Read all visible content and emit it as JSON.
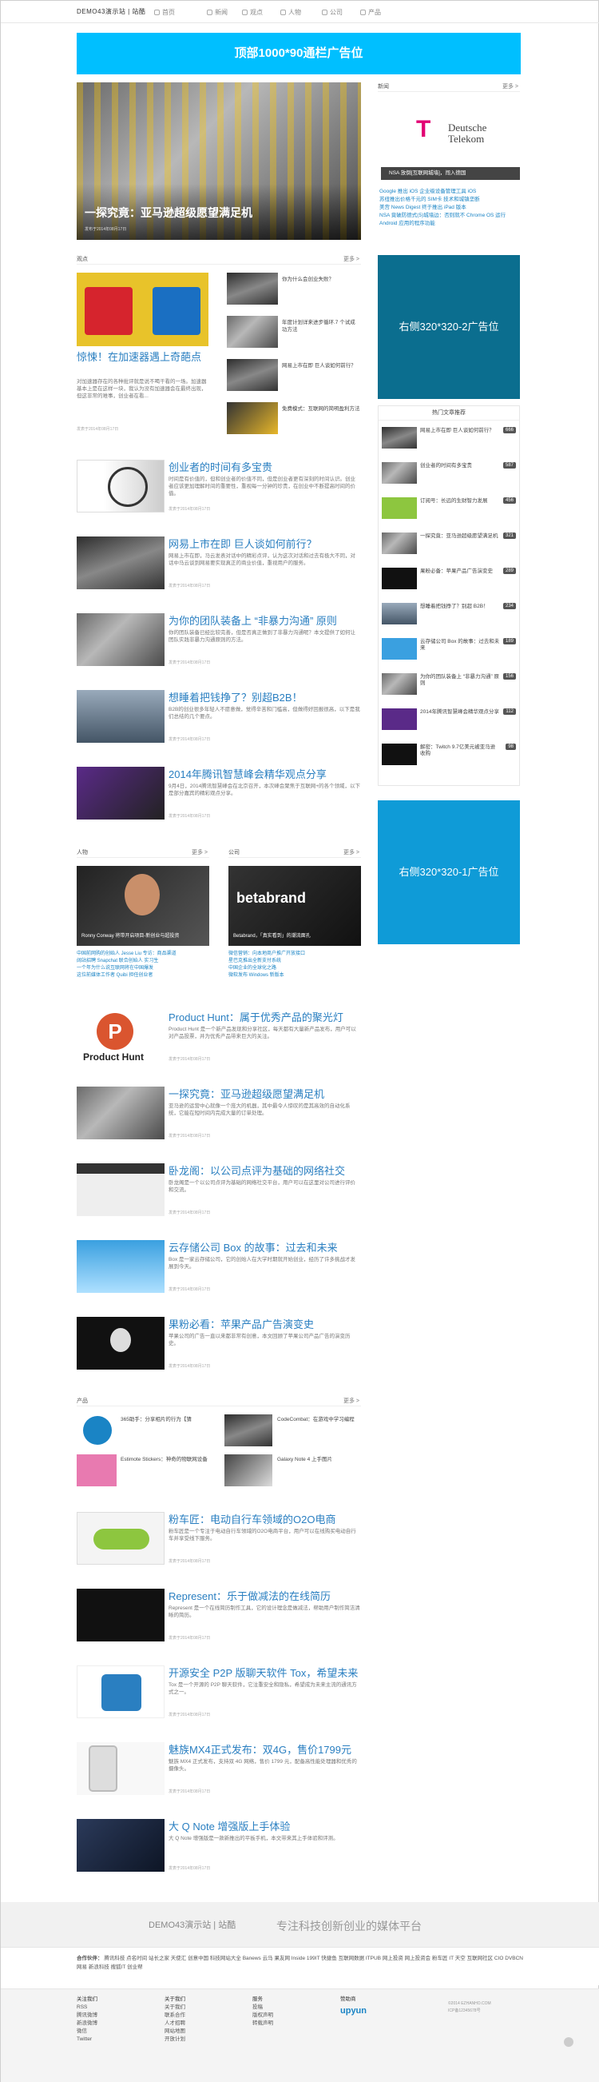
{
  "header": {
    "logo": "DEMO43演示站 | 站酷",
    "nav": [
      "首页",
      "新闻",
      "观点",
      "人物",
      "公司",
      "产品"
    ]
  },
  "ads": {
    "top": "顶部1000*90通栏广告位",
    "right1": "右侧320*320-2广告位",
    "right2": "右侧320*320-1广告位"
  },
  "hero": {
    "title": "一探究竟：亚马逊超级愿望满足机",
    "date": "发布于2014年08月17日"
  },
  "views": {
    "label": "观点",
    "more": "更多 >",
    "feature": {
      "title": "惊悚！在加速器遇上奇葩点",
      "desc": "对加速器存在的各种批评就是说不喝干看的一场。加速器基本上是在这样一块，我认为没有加速器会在最终出现，但这非常的难事，创业者在看...",
      "meta": "发表于2014年08月17日"
    },
    "side": [
      "你为什么会创业失败？",
      "年度计划详来进步循环.7 个试成功方法",
      "网易上市在即 巨人谈如何前行？",
      "免费模式：互联网的简明盈利方法"
    ]
  },
  "news": {
    "label": "新闻",
    "more": "更多 >",
    "brand": "Deutsche\nTelekom",
    "caption": "NSA 放倒[互联网城墙]，闯入德国",
    "links": [
      "Google 推出 iOS 企业级设备管理工具 iOS",
      "苏纽推出价格千元的 SIM卡 技术和城镇垄断",
      "美宫 News Digest 终于推出 iPad 版本",
      "NSA 竟破防德式(5)城墙边：否则就不 Chrome OS 运行 Android 应用的程序功能"
    ]
  },
  "articles": [
    {
      "title": "创业者的时间有多宝贵",
      "desc": "时间是有价值的，但和创业者的价值不同，但是创业者更有深刻的时间认识。创业者应该更加理解时间的重要性，重视每一分钟的珍贵，在创业中不断提高时间的价值。",
      "meta": "发表于2014年08月17日"
    },
    {
      "title": "网易上市在即 巨人谈如何前行？",
      "desc": "网易上市在即，马云发表对话中的精彩点评，认为这次对话和过去有极大不同，对话中马云谈到网易要实现真正的商业价值，重视用户的服务。",
      "meta": "发表于2014年08月17日"
    },
    {
      "title": "为你的团队装备上 “非暴力沟通” 原则",
      "desc": "你的团队装备已经比较完善，但是否真正做到了非暴力沟通呢？本文提供了如何让团队实践非暴力沟通原则的方法。",
      "meta": "发表于2014年08月17日"
    },
    {
      "title": "想睡着把钱挣了？别超B2B！",
      "desc": "B2B的创业很多年轻人不愿意做，觉得辛苦和门槛高，但做得好回报很高，以下是我们总结的几个要点。",
      "meta": "发表于2014年08月17日"
    },
    {
      "title": "2014年腾讯智慧峰会精华观点分享",
      "desc": "9月4日，2014腾讯智慧峰会在北京召开，本次峰会聚焦于互联网+的各个领域，以下是部分嘉宾的精彩观点分享。",
      "meta": "发表于2014年08月17日"
    }
  ],
  "people": {
    "label": "人物",
    "more": "更多 >",
    "caption": "Ronny Conway 将带开启项目-新创业与超投资",
    "links": [
      "中国前网购的创始人 Jesse Liu 专访：商品渠道",
      "阔站招聘 Snapchat 联合创始人 实习生",
      "一个年为什么说互联网将在中国爆发",
      "这位前媒体工作者 Quibi 担任创业者"
    ]
  },
  "company": {
    "label": "公司",
    "more": "更多 >",
    "caption": "Betabrand，「真实看到」的潮流面孔",
    "links": [
      "微信营销：向本地商户推广开放接口",
      "星巴克推出全新支付系统",
      "中国企业的全球化之路",
      "微软发布 Windows 新版本"
    ]
  },
  "articles2": [
    {
      "title": "Product Hunt：属于优秀产品的聚光灯",
      "desc": "Product Hunt 是一个新产品发现和分享社区，每天都有大量新产品发布，用户可以对产品投票，并为优秀产品带来巨大的关注。",
      "meta": "发表于2014年08月17日"
    },
    {
      "title": "一探究竟：亚马逊超级愿望满足机",
      "desc": "亚马逊的运营中心就像一个庞大的机器，其中最令人惊叹的是其高效的自动化系统，它能在短时间内完成大量的订单处理。",
      "meta": "发表于2014年08月17日"
    },
    {
      "title": "卧龙阁：以公司点评为基础的网络社交",
      "desc": "卧龙阁是一个以公司点评为基础的网络社交平台，用户可以在这里对公司进行评价和交流。",
      "meta": "发表于2014年08月17日"
    },
    {
      "title": "云存储公司 Box 的故事：过去和未来",
      "desc": "Box 是一家云存储公司，它的创始人在大学时期就开始创业，经历了许多挑战才发展到今天。",
      "meta": "发表于2014年08月17日"
    },
    {
      "title": "果粉必看：苹果产品广告演变史",
      "desc": "苹果公司的广告一直以来都非常有创意，本文回顾了苹果公司产品广告的演变历史。",
      "meta": "发表于2014年08月17日"
    }
  ],
  "products": {
    "label": "产品",
    "more": "更多 >",
    "items": [
      "365助手：分享相片的行为【猜",
      "CodeCombat：在游戏中学习编程",
      "Estimote Stickers：神奇的物联网设备",
      "Galaxy Note 4 上手图片"
    ]
  },
  "articles3": [
    {
      "title": "粉车匠：电动自行车领域的O2O电商",
      "desc": "粉车匠是一个专注于电动自行车领域的O2O电商平台，用户可以在线购买电动自行车并享受线下服务。",
      "meta": "发表于2014年08月17日"
    },
    {
      "title": "Represent：乐于做减法的在线简历",
      "desc": "Represent 是一个在线简历制作工具，它的设计理念是做减法，帮助用户制作简洁清晰的简历。",
      "meta": "发表于2014年08月17日"
    },
    {
      "title": "开源安全 P2P 版聊天软件 Tox，希望未来",
      "desc": "Tox 是一个开源的 P2P 聊天软件，它注重安全和隐私，希望成为未来主流的通讯方式之一。",
      "meta": "发表于2014年08月17日"
    },
    {
      "title": "魅族MX4正式发布：双4G，售价1799元",
      "desc": "魅族 MX4 正式发布，支持双 4G 网络，售价 1799 元，配备高性能处理器和优秀的摄像头。",
      "meta": "发表于2014年08月17日"
    },
    {
      "title": "大 Q Note 增强版上手体验",
      "desc": "大 Q Note 增强版是一款新推出的平板手机，本文带来其上手体验和评测。",
      "meta": "发表于2014年08月17日"
    }
  ],
  "hot": {
    "title": "热门文章推荐",
    "items": [
      {
        "t": "网易上市在即 巨人谈如何前行？",
        "n": "666"
      },
      {
        "t": "创业者的时间有多宝贵",
        "n": "587"
      },
      {
        "t": "订阅号：长远的生财智力发展",
        "n": "456"
      },
      {
        "t": "一探究竟：亚马逊超级愿望满足机",
        "n": "321"
      },
      {
        "t": "果粉必备：苹果产品广告演变史",
        "n": "289"
      },
      {
        "t": "想睡着把钱挣了？别超 B2B！",
        "n": "234"
      },
      {
        "t": "云存储公司 Box 的故事：过去和未来",
        "n": "189"
      },
      {
        "t": "为你的团队装备上 “非暴力沟通” 原则",
        "n": "156"
      },
      {
        "t": "2014年腾讯智慧峰会精华观点分享",
        "n": "112"
      },
      {
        "t": "解密：Twitch 9.7亿美元被亚马逊收购",
        "n": "98"
      }
    ]
  },
  "footer": {
    "logo": "DEMO43演示站 | 站酷",
    "slogan": "专注科技创新创业的媒体平台",
    "partners_label": "合作伙伴：",
    "partners": [
      "腾讯科技",
      "点名时间",
      "站长之家",
      "天使汇",
      "创意中国",
      "科技网站大全",
      "Banews",
      "云马",
      "果友网",
      "Inside",
      "199IT",
      "快捷鱼",
      "互联网数据",
      "ITPUB",
      "网上投资",
      "网上投资会",
      "粉车匠",
      "IT 天空",
      "互联网社区",
      "CIO",
      "DVBCN",
      "网易",
      "新浪科技",
      "搜狐IT",
      "创业帮"
    ],
    "cols": [
      {
        "h": "关注我们",
        "items": [
          "RSS",
          "腾讯微博",
          "新浪微博",
          "微信",
          "Twitter"
        ]
      },
      {
        "h": "关于我们",
        "items": [
          "关于我们",
          "联系合作",
          "人才招聘",
          "网站地图",
          "开放计划"
        ]
      },
      {
        "h": "服务",
        "items": [
          "投稿",
          "版权声明",
          "转载声明"
        ]
      },
      {
        "h": "赞助商",
        "items": [
          "upyun"
        ]
      }
    ],
    "copy1": "©2014 EZHANHO.COM",
    "copy2": "ICP备12345678号"
  }
}
